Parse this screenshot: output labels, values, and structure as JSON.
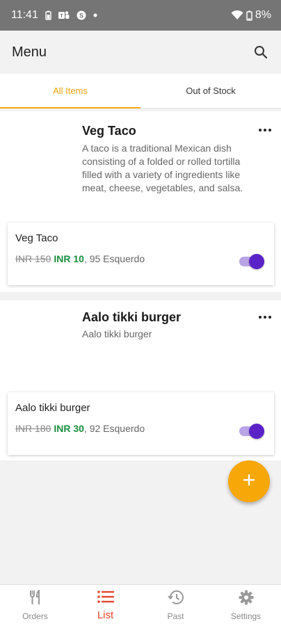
{
  "status_bar": {
    "time": "11:41",
    "battery": "8%"
  },
  "app_bar": {
    "title": "Menu"
  },
  "tabs": [
    {
      "label": "All Items",
      "active": true
    },
    {
      "label": "Out of Stock",
      "active": false
    }
  ],
  "items": [
    {
      "title": "Veg Taco",
      "description": "A taco is a traditional Mexican dish consisting of a folded or rolled tortilla filled with a variety of ingredients like meat, cheese, vegetables, and salsa.",
      "variant": {
        "name": "Veg Taco",
        "price_old": "INR 150",
        "price_new": "INR 10",
        "stock_info": ", 95 Esquerdo",
        "enabled": true
      }
    },
    {
      "title": "Aalo tikki burger",
      "description": "Aalo tikki burger",
      "variant": {
        "name": "Aalo tikki burger",
        "price_old": "INR 180",
        "price_new": "INR 30",
        "stock_info": ", 92 Esquerdo",
        "enabled": true
      }
    }
  ],
  "fab": {
    "icon": "plus-icon"
  },
  "bottom_nav": [
    {
      "label": "Orders",
      "icon": "fork-knife-icon",
      "active": false
    },
    {
      "label": "List",
      "icon": "list-icon",
      "active": true
    },
    {
      "label": "Past",
      "icon": "history-icon",
      "active": false
    },
    {
      "label": "Settings",
      "icon": "gear-icon",
      "active": false
    }
  ],
  "colors": {
    "accent": "#f5a70d",
    "price_green": "#1a8e3d",
    "toggle_thumb": "#5b23c7",
    "active_nav": "#e2452c"
  }
}
